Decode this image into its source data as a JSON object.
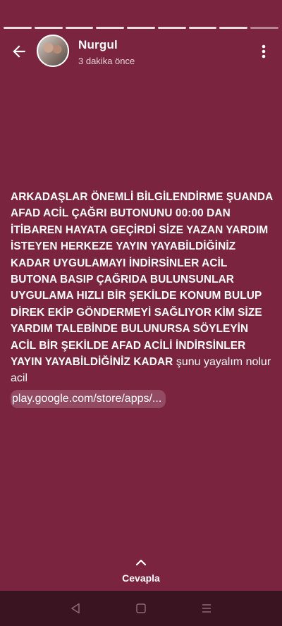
{
  "story": {
    "segments_total": 9,
    "segments_viewed": 8
  },
  "header": {
    "user_name": "Nurgul",
    "timestamp": "3 dakika önce"
  },
  "message": {
    "bold_text": "ARKADAŞLAR ÖNEMLİ BİLGİLENDİRME ŞUANDA AFAD ACİL ÇAĞRI BUTONUNU 00:00 DAN İTİBAREN HAYATA GEÇİRDİ SİZE YAZAN YARDIM İSTEYEN HERKEZE YAYIN YAYABİLDİĞİNİZ KADAR UYGULAMAYI İNDİRSİNLER ACİL BUTONA BASIP ÇAĞRIDA BULUNSUNLAR UYGULAMA HIZLI BİR ŞEKİLDE KONUM BULUP DİREK EKİP GÖNDERMEYİ SAĞLIYOR KİM SİZE YARDIM TALEBİNDE BULUNURSA SÖYLEYİN ACİL BİR ŞEKİLDE AFAD ACİLİ İNDİRSİNLER YAYIN YAYABİLDİĞİNİZ KADAR",
    "normal_text": " şunu yayalım nolur acil",
    "link_text": "play.google.com/store/apps/..."
  },
  "reply": {
    "label": "Cevapla"
  },
  "icons": {
    "back": "back-arrow-icon",
    "menu": "more-vert-icon",
    "reply": "chevron-up-icon",
    "nav_back": "nav-back-icon",
    "nav_home": "nav-home-icon",
    "nav_recents": "nav-recents-icon"
  },
  "colors": {
    "background": "#7a2440",
    "navbar": "#3a1420",
    "text": "#ffffff"
  }
}
